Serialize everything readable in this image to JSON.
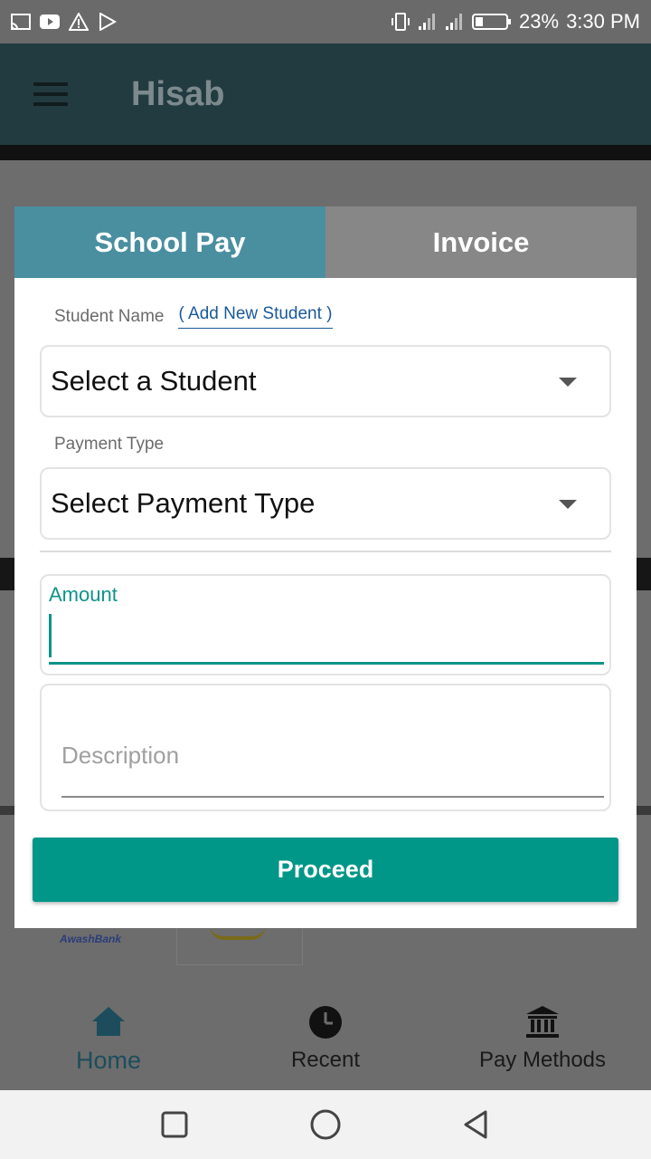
{
  "status_bar": {
    "battery": "23%",
    "time": "3:30 PM",
    "left_icons": [
      "cast-icon",
      "youtube-icon",
      "warning-icon",
      "play-store-icon"
    ],
    "right_icons": [
      "vibrate-icon",
      "signal-icon",
      "signal-icon",
      "battery-icon"
    ]
  },
  "app_bar": {
    "title": "Hisab"
  },
  "dialog": {
    "tabs": [
      {
        "label": "School Pay",
        "active": true
      },
      {
        "label": "Invoice",
        "active": false
      }
    ],
    "student_label": "Student Name",
    "add_student_link": "( Add New Student )",
    "student_select": "Select a Student",
    "payment_type_label": "Payment Type",
    "payment_type_select": "Select Payment Type",
    "amount_label": "Amount",
    "amount_value": "",
    "description_placeholder": "Description",
    "proceed_label": "Proceed"
  },
  "background": {
    "bank_logo_text": "AwashBank"
  },
  "bottom_nav": {
    "items": [
      {
        "label": "Home",
        "icon": "home-icon",
        "active": true
      },
      {
        "label": "Recent",
        "icon": "clock-icon",
        "active": false
      },
      {
        "label": "Pay Methods",
        "icon": "bank-icon",
        "active": false
      }
    ]
  },
  "colors": {
    "accent": "#009688",
    "tab_active": "#4a8fa0",
    "tab_inactive": "#878787",
    "link": "#1a5a9a"
  }
}
